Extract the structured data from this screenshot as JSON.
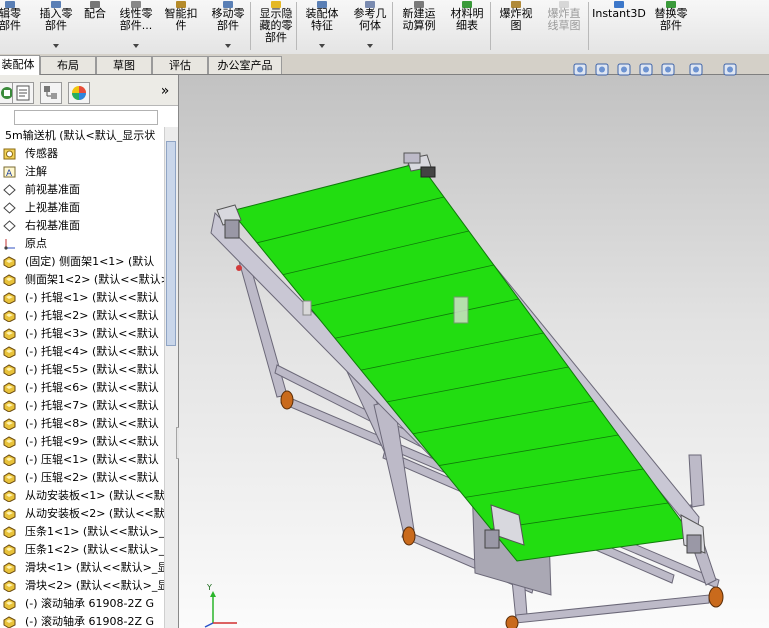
{
  "ribbon": {
    "buttons": [
      {
        "label": "辑零\n部件",
        "icon": "edit-component-icon",
        "has_arrow": false,
        "disabled": false
      },
      {
        "label": "插入零\n部件",
        "icon": "insert-component-icon",
        "has_arrow": true,
        "disabled": false
      },
      {
        "label": "配合",
        "icon": "mate-icon",
        "has_arrow": false,
        "disabled": false
      },
      {
        "label": "线性零\n部件...",
        "icon": "linear-pattern-icon",
        "has_arrow": true,
        "disabled": false
      },
      {
        "label": "智能扣\n件",
        "icon": "smart-fastener-icon",
        "has_arrow": false,
        "disabled": false
      },
      {
        "label": "移动零\n部件",
        "icon": "move-component-icon",
        "has_arrow": true,
        "disabled": false
      },
      {
        "label": "显示隐\n藏的零\n部件",
        "icon": "show-hidden-icon",
        "has_arrow": false,
        "disabled": false
      },
      {
        "label": "装配体\n特征",
        "icon": "assembly-feature-icon",
        "has_arrow": true,
        "disabled": false
      },
      {
        "label": "参考几\n何体",
        "icon": "reference-geometry-icon",
        "has_arrow": true,
        "disabled": false
      },
      {
        "label": "新建运\n动算例",
        "icon": "motion-study-icon",
        "has_arrow": false,
        "disabled": false
      },
      {
        "label": "材料明\n细表",
        "icon": "bom-icon",
        "has_arrow": false,
        "disabled": false
      },
      {
        "label": "爆炸视\n图",
        "icon": "exploded-view-icon",
        "has_arrow": false,
        "disabled": false
      },
      {
        "label": "爆炸直\n线草图",
        "icon": "explode-line-sketch-icon",
        "has_arrow": false,
        "disabled": true
      },
      {
        "label": "Instant3D",
        "icon": "instant3d-icon",
        "has_arrow": false,
        "disabled": false
      },
      {
        "label": "替换零\n部件",
        "icon": "replace-component-icon",
        "has_arrow": false,
        "disabled": false
      }
    ]
  },
  "tabs": [
    "装配体",
    "布局",
    "草图",
    "评估",
    "办公室产品"
  ],
  "active_tab": "装配体",
  "tree": {
    "items": [
      {
        "icon": "assembly-icon",
        "text": "5m输送机  (默认<默认_显示状"
      },
      {
        "icon": "sensor-icon",
        "text": "传感器"
      },
      {
        "icon": "annotation-icon",
        "text": "注解"
      },
      {
        "icon": "plane-icon",
        "text": "前视基准面"
      },
      {
        "icon": "plane-icon",
        "text": "上视基准面"
      },
      {
        "icon": "plane-icon",
        "text": "右视基准面"
      },
      {
        "icon": "origin-icon",
        "text": "原点"
      },
      {
        "icon": "part-icon",
        "text": "(固定) 侧面架1<1> (默认"
      },
      {
        "icon": "part-icon",
        "text": "侧面架1<2> (默认<<默认>"
      },
      {
        "icon": "part-icon",
        "text": "(-) 托辊<1> (默认<<默认"
      },
      {
        "icon": "part-icon",
        "text": "(-) 托辊<2> (默认<<默认"
      },
      {
        "icon": "part-icon",
        "text": "(-) 托辊<3> (默认<<默认"
      },
      {
        "icon": "part-icon",
        "text": "(-) 托辊<4> (默认<<默认"
      },
      {
        "icon": "part-icon",
        "text": "(-) 托辊<5> (默认<<默认"
      },
      {
        "icon": "part-icon",
        "text": "(-) 托辊<6> (默认<<默认"
      },
      {
        "icon": "part-icon",
        "text": "(-) 托辊<7> (默认<<默认"
      },
      {
        "icon": "part-icon",
        "text": "(-) 托辊<8> (默认<<默认"
      },
      {
        "icon": "part-icon",
        "text": "(-) 托辊<9> (默认<<默认"
      },
      {
        "icon": "part-icon",
        "text": "(-) 压辊<1> (默认<<默认"
      },
      {
        "icon": "part-icon",
        "text": "(-) 压辊<2> (默认<<默认"
      },
      {
        "icon": "part-icon",
        "text": "从动安装板<1> (默认<<默"
      },
      {
        "icon": "part-icon",
        "text": "从动安装板<2> (默认<<默"
      },
      {
        "icon": "part-icon",
        "text": "压条1<1> (默认<<默认>_显"
      },
      {
        "icon": "part-icon",
        "text": "压条1<2> (默认<<默认>_显"
      },
      {
        "icon": "part-icon",
        "text": "滑块<1> (默认<<默认>_显"
      },
      {
        "icon": "part-icon",
        "text": "滑块<2> (默认<<默认>_显"
      },
      {
        "icon": "part-icon",
        "text": "(-) 滚动轴承 61908-2Z G"
      },
      {
        "icon": "part-icon",
        "text": "(-) 滚动轴承 61908-2Z G"
      }
    ]
  },
  "panel": {
    "collapse_glyph": "»"
  },
  "view_toolbar": {
    "icons": [
      "zoom-to-fit-icon",
      "zoom-area-icon",
      "previous-view-icon",
      "section-view-icon",
      "view-orientation-icon",
      "display-style-icon",
      "hide-show-items-icon"
    ]
  },
  "triad": {
    "y_label": "Y",
    "x_label": "X"
  },
  "colors": {
    "belt": "#22dd11",
    "frame": "#bdbac8",
    "roller": "#c8c8c8",
    "wheel": "#c96a1c"
  }
}
